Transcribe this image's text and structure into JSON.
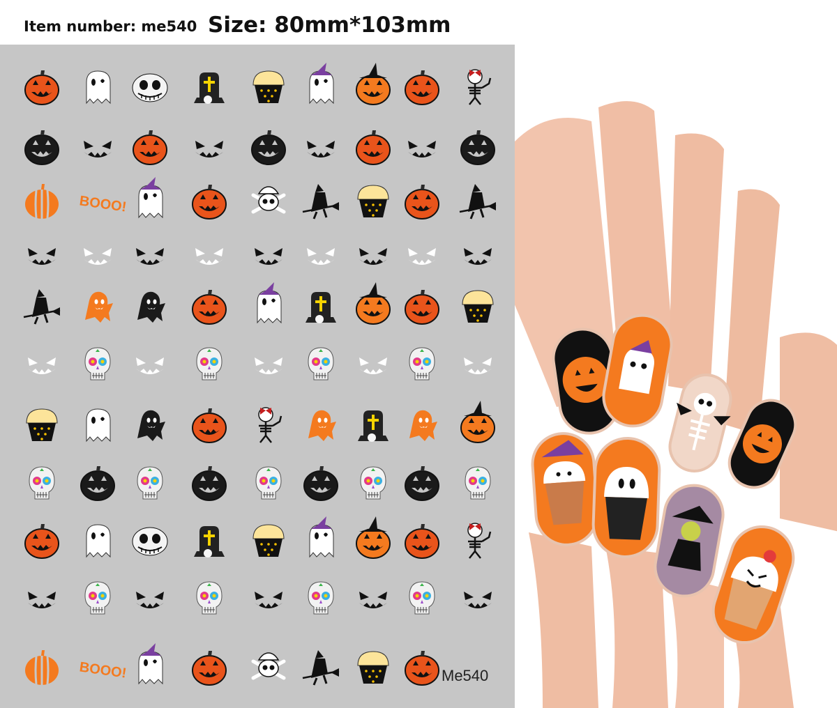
{
  "header": {
    "item_number": "Item number: me540",
    "size": "Size: 80mm*103mm"
  },
  "sheet": {
    "code_label": "Me540",
    "boo_text": "BOOO!",
    "rows": [
      [
        "pumpkin",
        "ghost",
        "skull-face",
        "tombstone",
        "cupcake",
        "ghost-witch",
        "pumpkin-witch",
        "pumpkin",
        "skeleton"
      ],
      [
        "pumpkin-black",
        "face-black",
        "pumpkin",
        "face-black",
        "pumpkin-black",
        "face-black",
        "pumpkin",
        "face-black",
        "pumpkin-black"
      ],
      [
        "pumpkin-plain",
        "boo",
        "ghost-witch",
        "pumpkin",
        "skull-bones",
        "witch",
        "cupcake",
        "pumpkin",
        "witch"
      ],
      [
        "face-black",
        "face-white",
        "face-black",
        "face-white",
        "face-black",
        "face-white",
        "face-black",
        "face-white",
        "face-black"
      ],
      [
        "witch",
        "ghost-orange",
        "ghost-black",
        "pumpkin",
        "ghost-witch",
        "tombstone",
        "pumpkin-witch",
        "pumpkin",
        "cupcake"
      ],
      [
        "face-white",
        "sugar-skull",
        "face-white",
        "sugar-skull",
        "face-white",
        "sugar-skull",
        "face-white",
        "sugar-skull",
        "face-white"
      ],
      [
        "cupcake",
        "ghost",
        "ghost-black",
        "pumpkin",
        "skeleton",
        "ghost-orange",
        "tombstone",
        "ghost-orange",
        "pumpkin-witch"
      ],
      [
        "sugar-skull",
        "pumpkin-black",
        "sugar-skull",
        "pumpkin-black",
        "sugar-skull",
        "pumpkin-black",
        "sugar-skull",
        "pumpkin-black",
        "sugar-skull"
      ],
      [
        "pumpkin",
        "ghost",
        "skull-face",
        "tombstone",
        "cupcake",
        "ghost-witch",
        "pumpkin-witch",
        "pumpkin",
        "skeleton"
      ],
      [
        "face-black",
        "sugar-skull",
        "face-black",
        "sugar-skull",
        "face-black",
        "sugar-skull",
        "face-black",
        "sugar-skull",
        "face-black"
      ],
      [
        "pumpkin-plain",
        "boo",
        "ghost-witch",
        "pumpkin",
        "skull-bones",
        "witch",
        "cupcake",
        "pumpkin"
      ]
    ]
  },
  "photo": {
    "nails": [
      "pumpkin-nail",
      "ghost-witch-nail",
      "skeleton-nail",
      "pumpkin-black-nail",
      "cupcake-witch-nail",
      "ghost-nail",
      "witch-nail",
      "cupcake-nail"
    ]
  },
  "colors": {
    "sheet_bg": "#c6c6c6",
    "pumpkin_orange": "#e9541b",
    "bright_orange": "#f47a1f",
    "black": "#1a1a1a",
    "purple": "#7a3fa0"
  }
}
